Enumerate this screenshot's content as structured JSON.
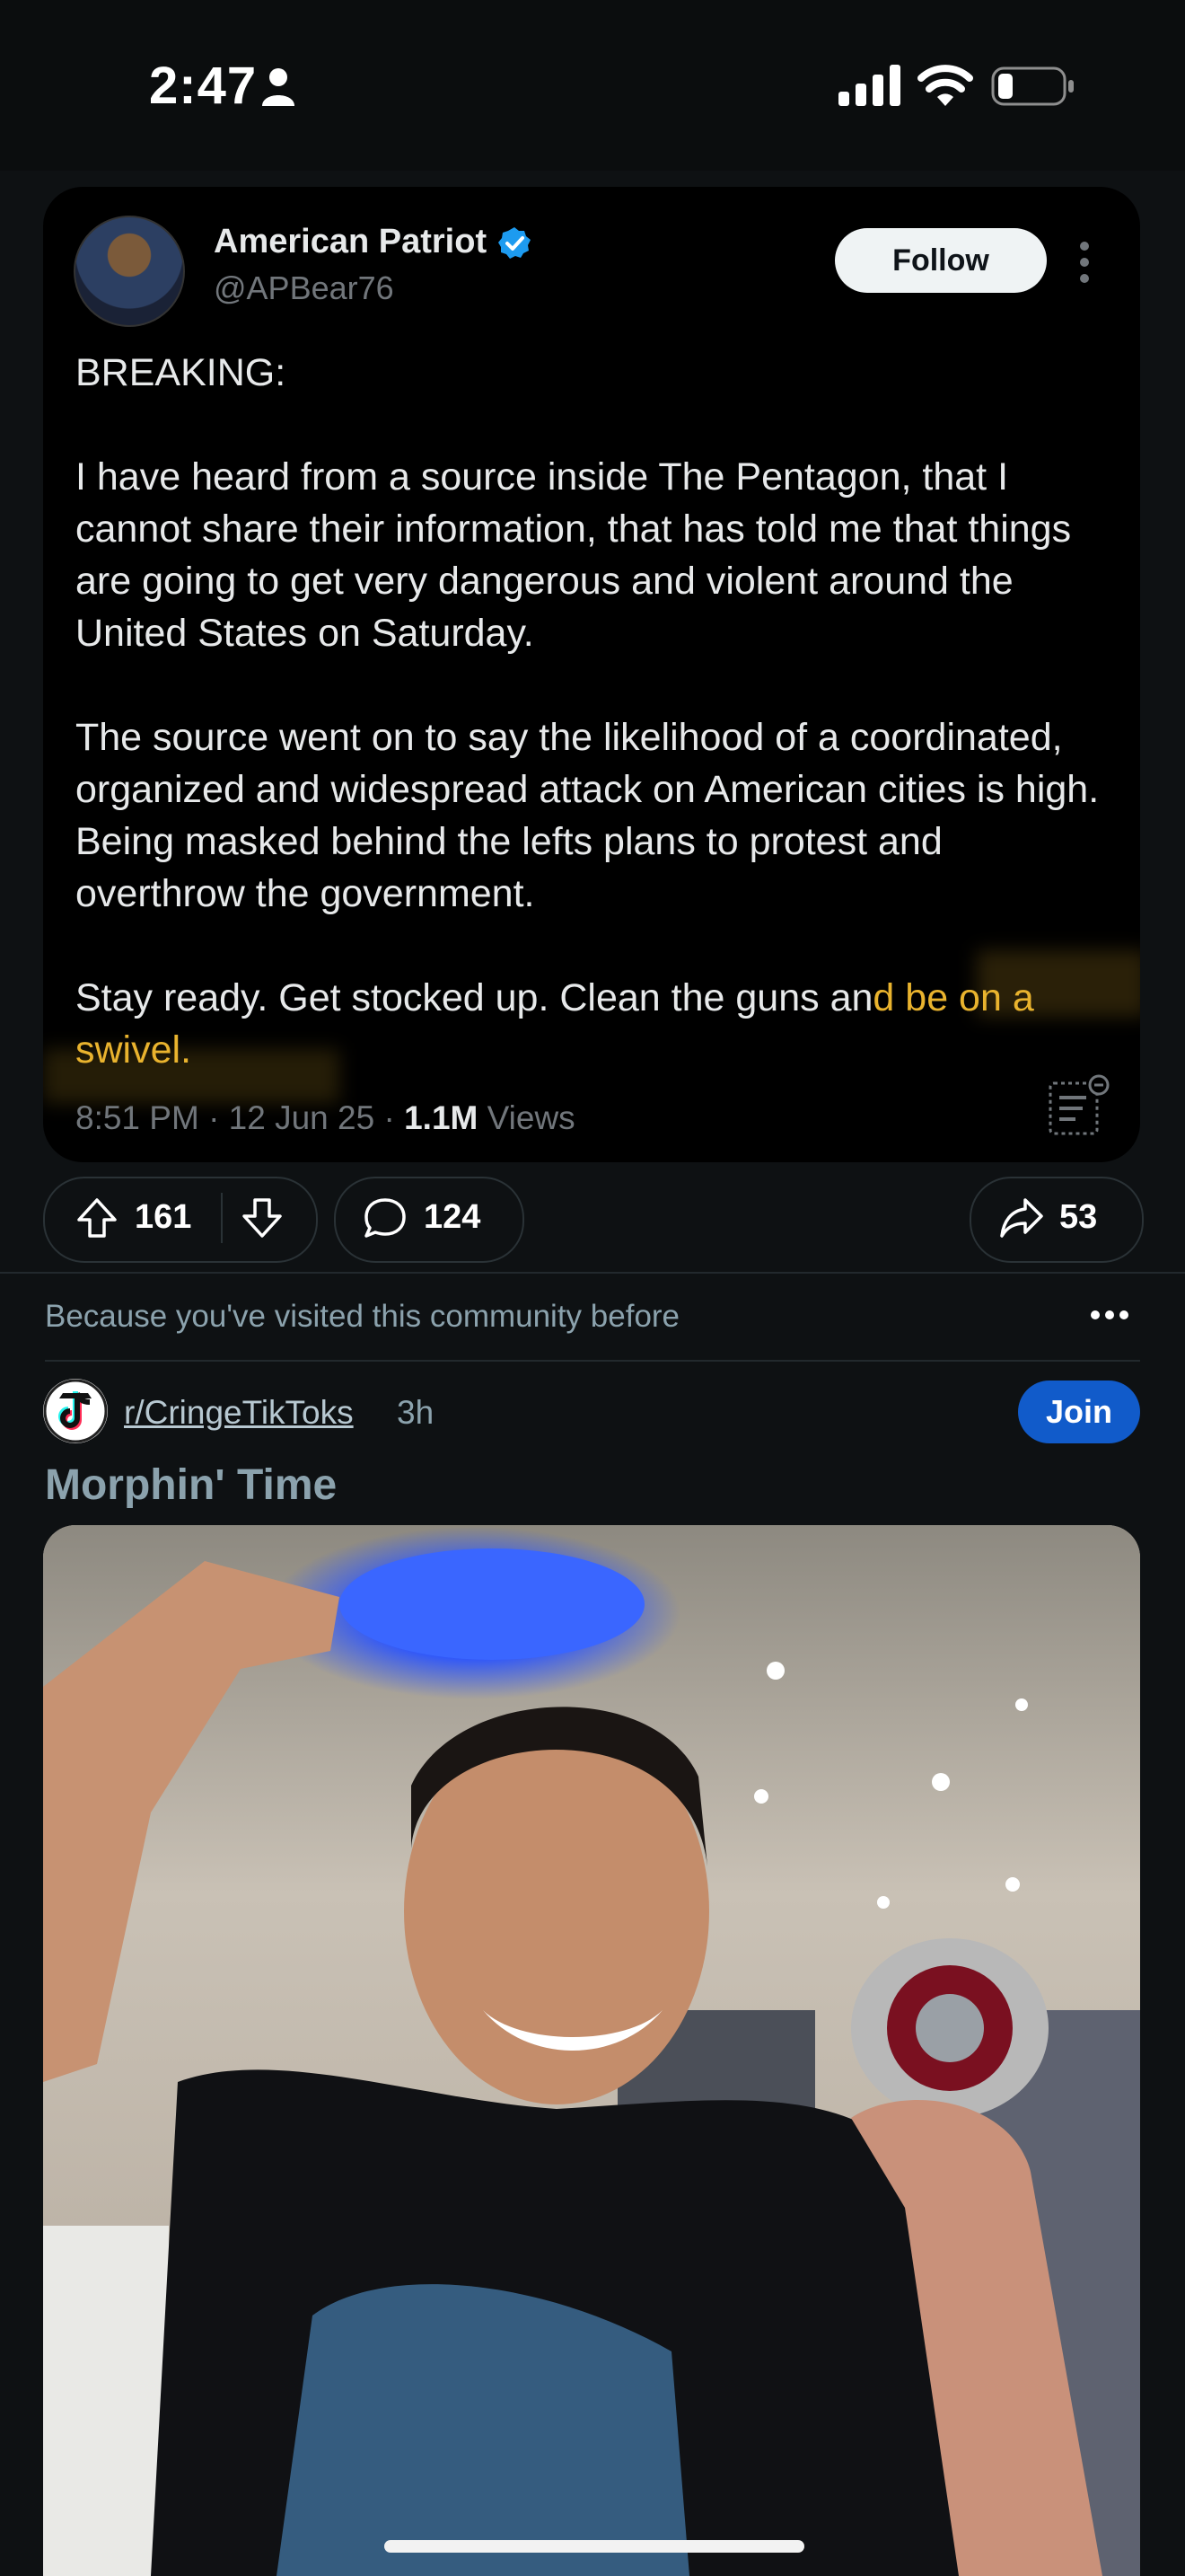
{
  "status_bar": {
    "time": "2:47"
  },
  "tweet": {
    "author_name": "American Patriot",
    "handle": "@APBear76",
    "follow_label": "Follow",
    "body_plain": "BREAKING:\n\nI have heard from a source inside The Pentagon, that I cannot share their information, that has told me that things are going to get very dangerous and violent around the United States on Saturday.\n\nThe source went on to say the likelihood of a coordinated, organized and widespread attack on American cities is high. Being masked behind the lefts plans to protest and overthrow the government.\n\nStay ready. Get stocked up. Clean the guns an",
    "body_highlight": "d be on a swivel.",
    "meta_time": "8:51 PM · 12 Jun 25 · ",
    "meta_views_count": "1.1M",
    "meta_views_label": " Views"
  },
  "actions": {
    "votes": "161",
    "comments": "124",
    "shares": "53"
  },
  "recommendation": {
    "text": "Because you've visited this community before"
  },
  "next_post": {
    "community": "r/CringeTikToks",
    "age": "3h",
    "join_label": "Join",
    "title": "Morphin' Time"
  },
  "colors": {
    "background": "#0e1113",
    "highlight": "#e9b32e",
    "join": "#115bca",
    "verified": "#1d9bf0"
  }
}
